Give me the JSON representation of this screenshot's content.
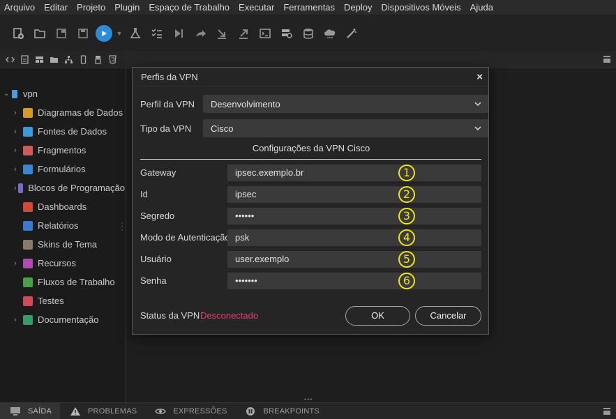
{
  "menu": [
    "Arquivo",
    "Editar",
    "Projeto",
    "Plugin",
    "Espaço de Trabalho",
    "Executar",
    "Ferramentas",
    "Deploy",
    "Dispositivos Móveis",
    "Ajuda"
  ],
  "tree": {
    "root": "vpn",
    "items": [
      {
        "label": "Diagramas de Dados",
        "chevron": true,
        "color": "#d59a2a"
      },
      {
        "label": "Fontes de Dados",
        "chevron": true,
        "color": "#3e9ad6"
      },
      {
        "label": "Fragmentos",
        "chevron": true,
        "color": "#d05a5a"
      },
      {
        "label": "Formulários",
        "chevron": true,
        "color": "#3a86d0"
      },
      {
        "label": "Blocos de Programação",
        "chevron": true,
        "color": "#7a6ad0"
      },
      {
        "label": "Dashboards",
        "chevron": false,
        "color": "#d04a3a"
      },
      {
        "label": "Relatórios",
        "chevron": false,
        "color": "#3a7ad0"
      },
      {
        "label": "Skins de Tema",
        "chevron": false,
        "color": "#8a7a6a"
      },
      {
        "label": "Recursos",
        "chevron": true,
        "color": "#b04ab0"
      },
      {
        "label": "Fluxos de Trabalho",
        "chevron": false,
        "color": "#4aa04a"
      },
      {
        "label": "Testes",
        "chevron": false,
        "color": "#d04a5a"
      },
      {
        "label": "Documentação",
        "chevron": true,
        "color": "#3a9a6a"
      }
    ]
  },
  "bottom_tabs": [
    "SAÍDA",
    "PROBLEMAS",
    "EXPRESSÕES",
    "BREAKPOINTS"
  ],
  "dialog": {
    "title": "Perfis da VPN",
    "close": "×",
    "profile_label": "Perfil da VPN",
    "profile_value": "Desenvolvimento",
    "type_label": "Tipo da VPN",
    "type_value": "Cisco",
    "section_title": "Configurações da VPN Cisco",
    "fields": [
      {
        "label": "Gateway",
        "value": "ipsec.exemplo.br",
        "badge": "1"
      },
      {
        "label": "Id",
        "value": "ipsec",
        "badge": "2"
      },
      {
        "label": "Segredo",
        "value": "••••••",
        "badge": "3"
      },
      {
        "label": "Modo de Autenticação",
        "value": "psk",
        "badge": "4"
      },
      {
        "label": "Usuário",
        "value": "user.exemplo",
        "badge": "5"
      },
      {
        "label": "Senha",
        "value": "•••••••",
        "badge": "6"
      }
    ],
    "status_label": "Status da VPN",
    "status_value": "Desconectado",
    "ok_label": "OK",
    "cancel_label": "Cancelar"
  },
  "colors": {
    "accent": "#2e8bd8",
    "status_disconnected": "#e0416d",
    "annotation": "#f2e21a"
  }
}
